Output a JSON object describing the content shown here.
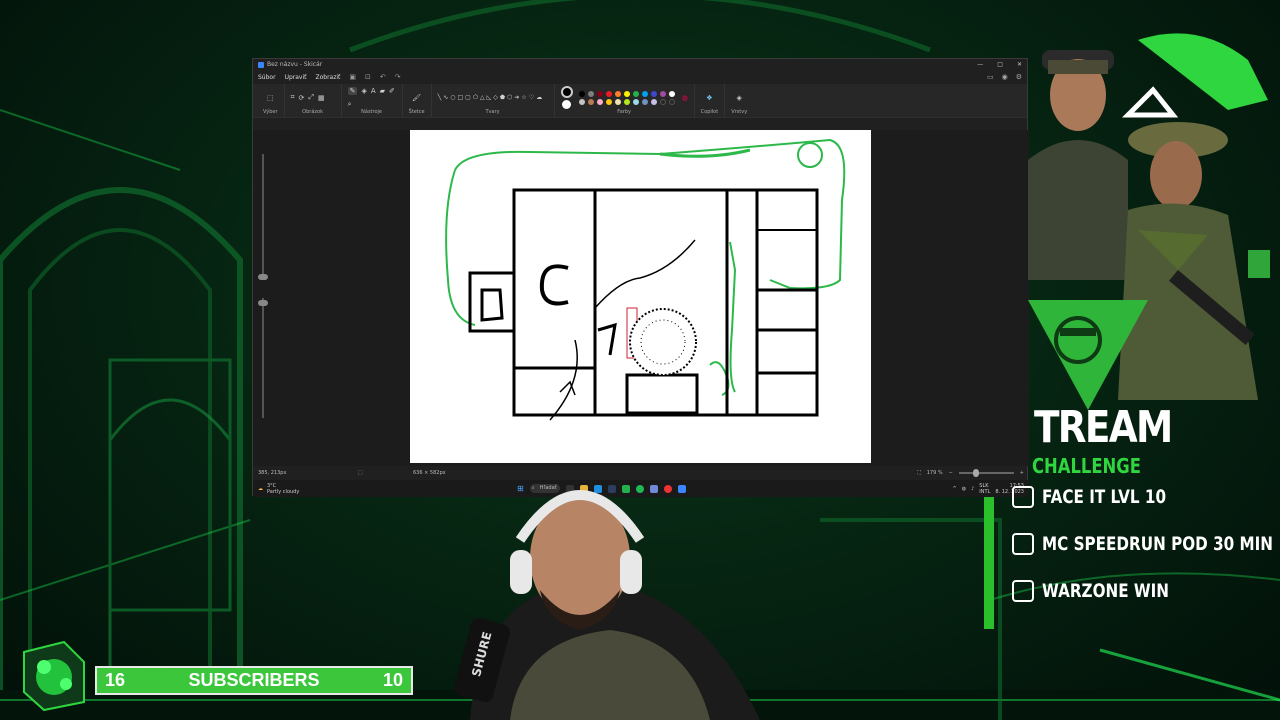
{
  "paint": {
    "window_title": "Bez názvu - Skicár",
    "menu": [
      "Súbor",
      "Upraviť",
      "Zobraziť"
    ],
    "ribbon_groups": [
      "Výber",
      "Obrázok",
      "Nástroje",
      "Štetce",
      "Tvary",
      "Farby",
      "Copilot",
      "Vrstvy"
    ],
    "status_position": "385, 213px",
    "status_size": "636 × 582px",
    "zoom": "179 %",
    "weather_temp": "3°C",
    "weather_desc": "Partly cloudy",
    "search_label": "Hľadať",
    "tray_lang_1": "SLK",
    "tray_lang_2": "INTL",
    "clock_time": "17:53",
    "clock_date": "8. 12. 2023",
    "palette": [
      "#000000",
      "#7f7f7f",
      "#880015",
      "#ed1c24",
      "#ff7f27",
      "#fff200",
      "#22b14c",
      "#00a2e8",
      "#3f48cc",
      "#a349a4",
      "#ffffff",
      "#c3c3c3",
      "#b97a57",
      "#ffaec9",
      "#ffc90e",
      "#efe4b0",
      "#b5e61d",
      "#99d9ea",
      "#7092be",
      "#c8bfe7"
    ]
  },
  "challenge": {
    "title": "TREAM",
    "subtitle": "CHALLENGE",
    "goals": [
      "FACE IT LVL 10",
      "MC SPEEDRUN POD 30 MIN",
      "WARZONE WIN"
    ]
  },
  "subscribers": {
    "left_value": "16",
    "label": "SUBSCRIBERS",
    "right_value": "10"
  },
  "colors": {
    "accent_green": "#3cc63c",
    "dark_green": "#062512",
    "paint_bg": "#202020"
  }
}
